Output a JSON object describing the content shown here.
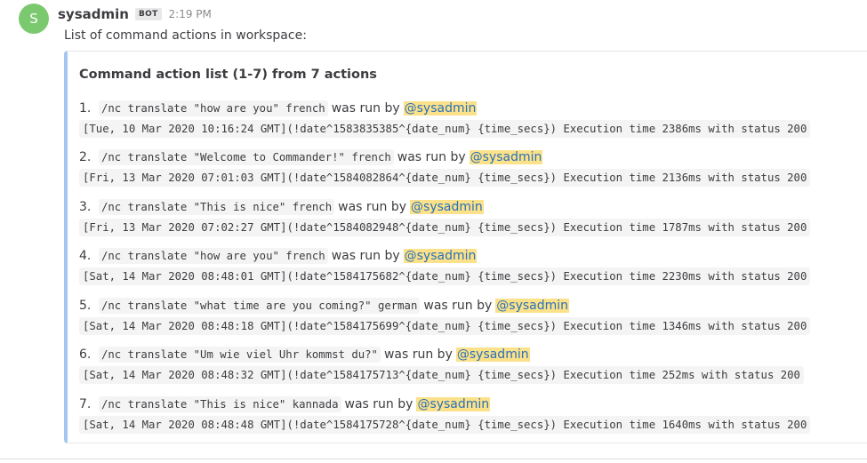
{
  "post": {
    "avatar_letter": "S",
    "username": "sysadmin",
    "badge": "BOT",
    "time": "2:19 PM",
    "message": "List of command actions in workspace:",
    "avatar_color": "#7bc96f",
    "accent_color": "#a4c7ef",
    "mention_highlight": "#fbe28a"
  },
  "attachment": {
    "title": "Command action list (1-7) from 7 actions",
    "actions": [
      {
        "number": "1.",
        "command": "/nc translate \"how are you\" french",
        "was_run_by": "was run by",
        "user": "@sysadmin",
        "detail": "[Tue, 10 Mar 2020 10:16:24 GMT](!date^1583835385^{date_num} {time_secs}) Execution time 2386ms with status 200"
      },
      {
        "number": "2.",
        "command": "/nc translate \"Welcome to Commander!\" french",
        "was_run_by": "was run by",
        "user": "@sysadmin",
        "detail": "[Fri, 13 Mar 2020 07:01:03 GMT](!date^1584082864^{date_num} {time_secs}) Execution time 2136ms with status 200"
      },
      {
        "number": "3.",
        "command": "/nc translate \"This is nice\" french",
        "was_run_by": "was run by",
        "user": "@sysadmin",
        "detail": "[Fri, 13 Mar 2020 07:02:27 GMT](!date^1584082948^{date_num} {time_secs}) Execution time 1787ms with status 200"
      },
      {
        "number": "4.",
        "command": "/nc translate \"how are you\" french",
        "was_run_by": "was run by",
        "user": "@sysadmin",
        "detail": "[Sat, 14 Mar 2020 08:48:01 GMT](!date^1584175682^{date_num} {time_secs}) Execution time 2230ms with status 200"
      },
      {
        "number": "5.",
        "command": "/nc translate \"what time are you coming?\" german",
        "was_run_by": "was run by",
        "user": "@sysadmin",
        "detail": "[Sat, 14 Mar 2020 08:48:18 GMT](!date^1584175699^{date_num} {time_secs}) Execution time 1346ms with status 200"
      },
      {
        "number": "6.",
        "command": "/nc translate \"Um wie viel Uhr kommst du?\"",
        "was_run_by": "was run by",
        "user": "@sysadmin",
        "detail": "[Sat, 14 Mar 2020 08:48:32 GMT](!date^1584175713^{date_num} {time_secs}) Execution time 252ms with status 200"
      },
      {
        "number": "7.",
        "command": "/nc translate \"This is nice\" kannada",
        "was_run_by": "was run by",
        "user": "@sysadmin",
        "detail": "[Sat, 14 Mar 2020 08:48:48 GMT](!date^1584175728^{date_num} {time_secs}) Execution time 1640ms with status 200"
      }
    ]
  }
}
